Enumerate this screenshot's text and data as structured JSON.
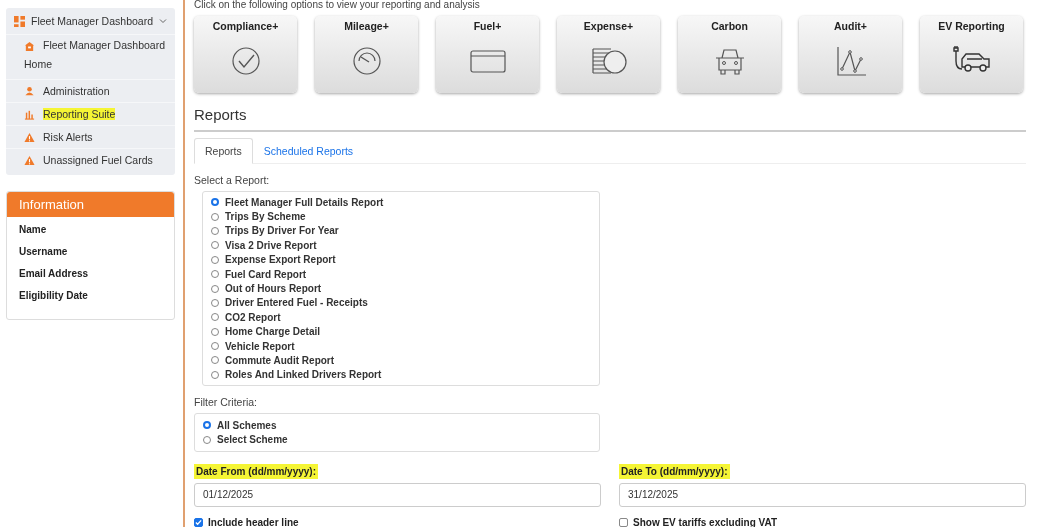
{
  "intro": "Click on the following options to view your reporting and analysis",
  "sidebar": {
    "menu": {
      "title": "Fleet Manager Dashboard",
      "expanded": true,
      "items": [
        {
          "label": "Fleet Manager Dashboard Home",
          "kind": "home",
          "highlighted": false
        },
        {
          "label": "Administration",
          "kind": "person",
          "highlighted": false
        },
        {
          "label": "Reporting Suite",
          "kind": "chart",
          "highlighted": true
        },
        {
          "label": "Risk Alerts",
          "kind": "warning",
          "highlighted": false
        },
        {
          "label": "Unassigned Fuel Cards",
          "kind": "warning",
          "highlighted": false
        }
      ]
    },
    "info": {
      "title": "Information",
      "fields": [
        "Name",
        "Username",
        "Email Address",
        "Eligibility Date"
      ]
    }
  },
  "tiles": [
    {
      "label": "Compliance+",
      "kind": "check"
    },
    {
      "label": "Mileage+",
      "kind": "gauge"
    },
    {
      "label": "Fuel+",
      "kind": "card"
    },
    {
      "label": "Expense+",
      "kind": "coins"
    },
    {
      "label": "Carbon",
      "kind": "car"
    },
    {
      "label": "Audit+",
      "kind": "linechart"
    },
    {
      "label": "EV Reporting",
      "kind": "ev"
    }
  ],
  "section_title": "Reports",
  "tabs": [
    {
      "label": "Reports",
      "selected": true
    },
    {
      "label": "Scheduled Reports",
      "selected": false
    }
  ],
  "report_label": "Select a Report:",
  "reports": [
    {
      "label": "Fleet Manager Full Details Report",
      "selected": true
    },
    {
      "label": "Trips By Scheme",
      "selected": false
    },
    {
      "label": "Trips By Driver For Year",
      "selected": false
    },
    {
      "label": "Visa 2 Drive Report",
      "selected": false
    },
    {
      "label": "Expense Export Report",
      "selected": false
    },
    {
      "label": "Fuel Card Report",
      "selected": false
    },
    {
      "label": "Out of Hours Report",
      "selected": false
    },
    {
      "label": "Driver Entered Fuel - Receipts",
      "selected": false
    },
    {
      "label": "CO2 Report",
      "selected": false
    },
    {
      "label": "Home Charge Detail",
      "selected": false
    },
    {
      "label": "Vehicle Report",
      "selected": false
    },
    {
      "label": "Commute Audit Report",
      "selected": false
    },
    {
      "label": "Roles And Linked Drivers Report",
      "selected": false
    }
  ],
  "filter": {
    "label": "Filter Criteria:",
    "options": [
      {
        "label": "All Schemes",
        "selected": true
      },
      {
        "label": "Select Scheme",
        "selected": false
      }
    ]
  },
  "dates": [
    {
      "label": "Date From (dd/mm/yyyy):",
      "value": "01/12/2025",
      "highlighted": true
    },
    {
      "label": "Date To (dd/mm/yyyy):",
      "value": "31/12/2025",
      "highlighted": true
    }
  ],
  "checkboxes": [
    {
      "label": "Include header line",
      "checked": true
    },
    {
      "label": "Show EV tariffs excluding VAT",
      "checked": false
    }
  ]
}
